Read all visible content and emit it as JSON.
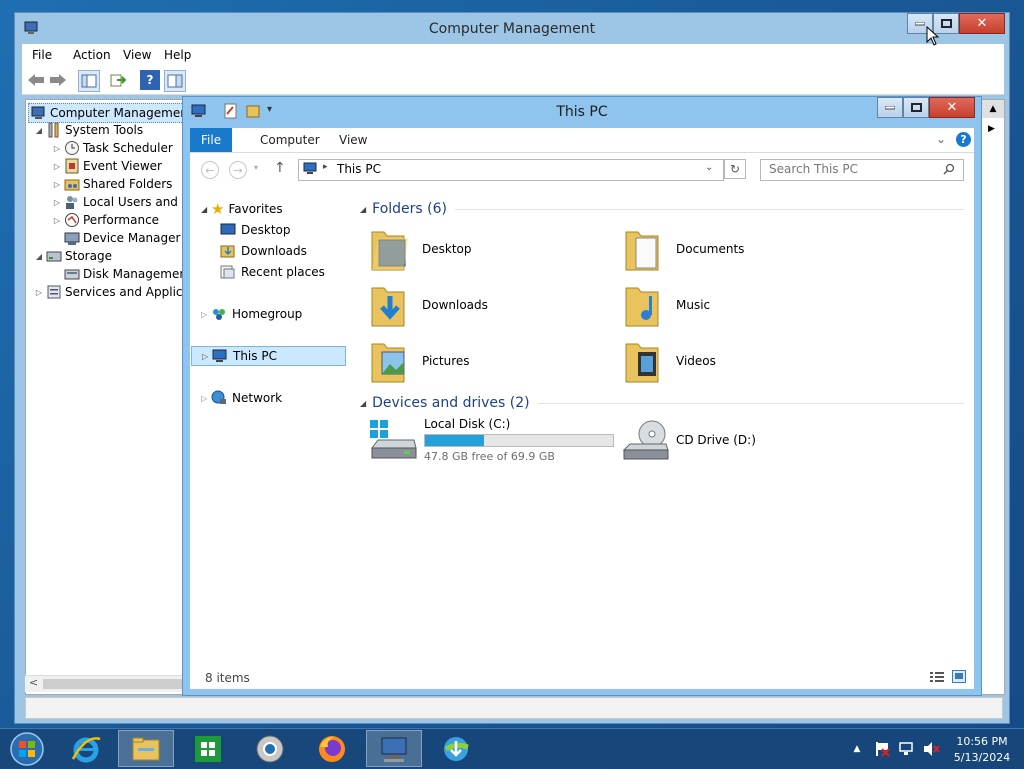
{
  "computer_management": {
    "title": "Computer Management",
    "menu": [
      "File",
      "Action",
      "View",
      "Help"
    ],
    "tree": {
      "root": "Computer Management (Local)",
      "system_tools": "System Tools",
      "task_scheduler": "Task Scheduler",
      "event_viewer": "Event Viewer",
      "shared_folders": "Shared Folders",
      "local_users": "Local Users and Groups",
      "performance": "Performance",
      "device_manager": "Device Manager",
      "storage": "Storage",
      "disk_management": "Disk Management",
      "services": "Services and Applications"
    }
  },
  "explorer": {
    "title": "This PC",
    "ribbon_tabs": [
      "File",
      "Computer",
      "View"
    ],
    "address": "This PC",
    "search_placeholder": "Search This PC",
    "nav": {
      "favorites": "Favorites",
      "desktop": "Desktop",
      "downloads": "Downloads",
      "recent": "Recent places",
      "homegroup": "Homegroup",
      "this_pc": "This PC",
      "network": "Network"
    },
    "folders_header": "Folders (6)",
    "folders": [
      "Desktop",
      "Documents",
      "Downloads",
      "Music",
      "Pictures",
      "Videos"
    ],
    "devices_header": "Devices and drives (2)",
    "local_disk": {
      "name": "Local Disk (C:)",
      "free": "47.8 GB free of 69.9 GB",
      "used_fraction": 0.316
    },
    "cd_drive": "CD Drive (D:)",
    "status": "8 items"
  },
  "taskbar": {
    "time": "10:56 PM",
    "date": "5/13/2024"
  },
  "colors": {
    "accent": "#1979ca",
    "drive_fill": "#26a0da"
  }
}
